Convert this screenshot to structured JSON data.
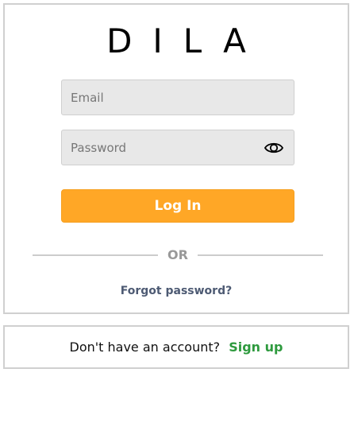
{
  "brand": {
    "logo_text": "DILA"
  },
  "form": {
    "email_placeholder": "Email",
    "email_value": "",
    "password_placeholder": "Password",
    "password_value": "",
    "login_label": "Log In",
    "divider_text": "OR",
    "forgot_password_label": "Forgot password?"
  },
  "signup": {
    "prompt_text": "Don't have an account?",
    "link_label": "Sign up"
  },
  "colors": {
    "accent": "#ffa726",
    "signup_link": "#2e9a3e",
    "forgot_link": "#4d5a73",
    "field_bg": "#e8e8e8",
    "border": "#d0d0d0"
  },
  "icons": {
    "password_toggle": "eye-icon"
  }
}
